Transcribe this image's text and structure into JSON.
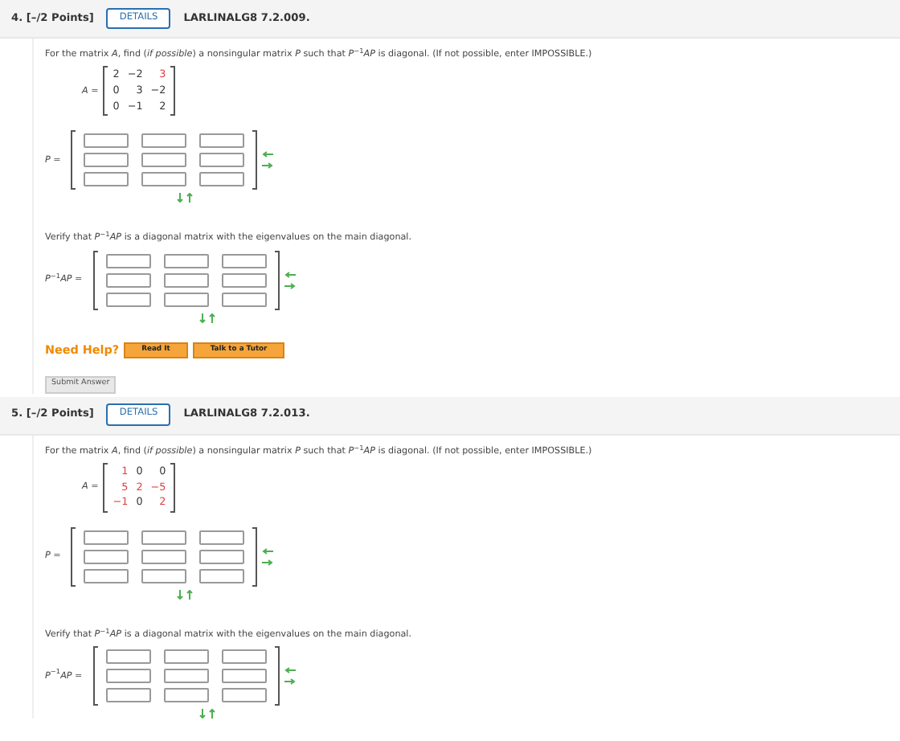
{
  "questions": [
    {
      "number": "4.",
      "points": "[–/2 Points]",
      "details_button": "DETAILS",
      "reference": "LARLINALG8 7.2.009.",
      "prompt": "For the matrix *A*, find (*if possible*) a nonsingular matrix *P* such that *P*$^{−1}$*AP* is diagonal. (If not possible, enter IMPOSSIBLE.)",
      "matrix_label": "*A* =",
      "matrix": [
        [
          {
            "value": "2",
            "color": "#333333"
          },
          {
            "value": "−2",
            "color": "#333333"
          },
          {
            "value": "3",
            "color": "#e03c3c"
          }
        ],
        [
          {
            "value": "0",
            "color": "#333333"
          },
          {
            "value": "3",
            "color": "#333333"
          },
          {
            "value": "−2",
            "color": "#333333"
          }
        ],
        [
          {
            "value": "0",
            "color": "#333333"
          },
          {
            "value": "−1",
            "color": "#333333"
          },
          {
            "value": "2",
            "color": "#333333"
          }
        ]
      ],
      "answer_label": "*P* =",
      "verify_text": "Verify that *P*$^{−1}$*AP* is a diagonal matrix with the eigenvalues on the main diagonal.",
      "verify_label": "*P*$^{−1}$*AP* =",
      "help": {
        "label": "Need Help?",
        "buttons": [
          "Read It",
          "Talk to a Tutor"
        ]
      },
      "submit_button": "Submit Answer"
    },
    {
      "number": "5.",
      "points": "[–/2 Points]",
      "details_button": "DETAILS",
      "reference": "LARLINALG8 7.2.013.",
      "prompt": "For the matrix *A*, find (*if possible*) a nonsingular matrix *P* such that *P*$^{−1}$*AP* is diagonal. (If not possible, enter IMPOSSIBLE.)",
      "matrix_label": "*A* =",
      "matrix": [
        [
          {
            "value": "1",
            "color": "#e03c3c"
          },
          {
            "value": "0",
            "color": "#333333"
          },
          {
            "value": "0",
            "color": "#333333"
          }
        ],
        [
          {
            "value": "5",
            "color": "#e03c3c"
          },
          {
            "value": "2",
            "color": "#e03c3c"
          },
          {
            "value": "−5",
            "color": "#e03c3c"
          }
        ],
        [
          {
            "value": "−1",
            "color": "#e03c3c"
          },
          {
            "value": "0",
            "color": "#333333"
          },
          {
            "value": "2",
            "color": "#e03c3c"
          }
        ]
      ],
      "answer_label": "*P* =",
      "verify_text": "Verify that *P*$^{−1}$*AP* is a diagonal matrix with the eigenvalues on the main diagonal.",
      "verify_label": "*P*$^{−1}$*AP* ="
    }
  ]
}
